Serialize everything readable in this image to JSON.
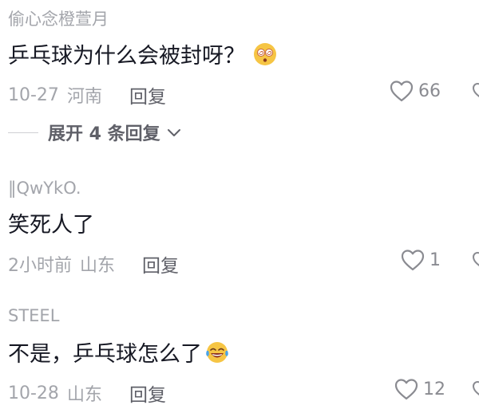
{
  "comments": [
    {
      "username": "偷心念橙萱月",
      "text": "乒乓球为什么会被封呀？",
      "emoji": "dizzy-face-emoji",
      "date": "10-27",
      "location": "河南",
      "reply_label": "回复",
      "likes": "66",
      "expand_label": "展开 4 条回复"
    },
    {
      "username": "‖QwYkO.",
      "text": "笑死人了",
      "date": "2小时前",
      "location": "山东",
      "reply_label": "回复",
      "likes": "1"
    },
    {
      "username": "STEEL",
      "text": "不是，乒乓球怎么了",
      "emoji": "tears-of-joy-emoji",
      "date": "10-28",
      "location": "山东",
      "reply_label": "回复",
      "likes": "12"
    }
  ],
  "colors": {
    "primary_text": "#161823",
    "secondary_text": "#a3a5ab",
    "reply_text": "#5f6068",
    "icon": "#8a8b91"
  },
  "icons": [
    "heart-outline-icon",
    "chevron-down-icon"
  ]
}
